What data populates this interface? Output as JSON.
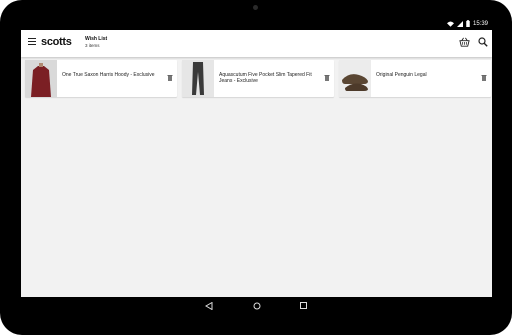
{
  "status_bar": {
    "time": "15:39"
  },
  "app": {
    "logo": "scotts",
    "title": "Wish List",
    "subtitle": "3 items"
  },
  "items": [
    {
      "name": "One True Saxon Harris Hoody - Exclusive"
    },
    {
      "name": "Aquascutum Five Pocket Slim Tapered Fit Jeans - Exclusive"
    },
    {
      "name": "Original Penguin Legal"
    }
  ]
}
